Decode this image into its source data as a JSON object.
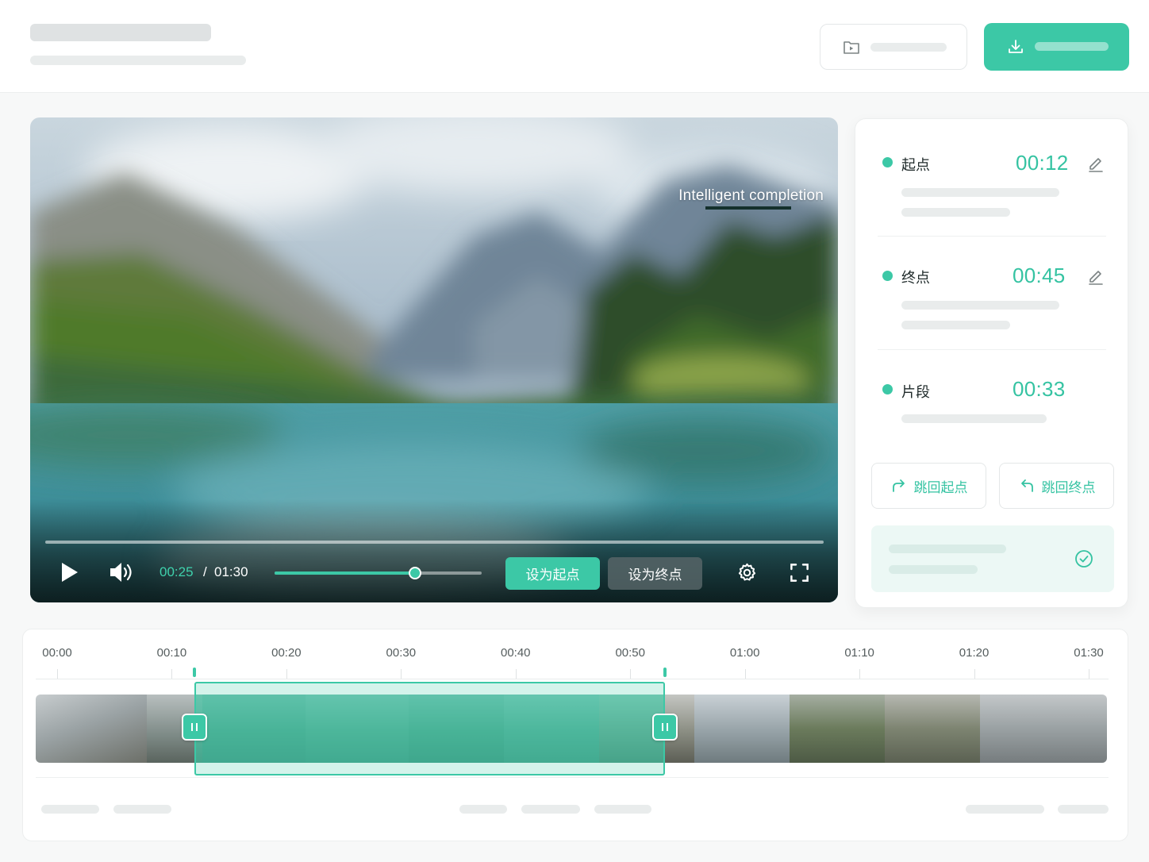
{
  "header": {
    "title_placeholder": "",
    "subtitle_placeholder": "",
    "open_button_icon": "video-file-icon",
    "export_button_icon": "download-icon"
  },
  "video": {
    "overlay_text": "Intelligent completion",
    "current_time": "00:25",
    "separator": "/",
    "total_time": "01:30",
    "progress_fraction": 0.0,
    "volume_fraction": 0.68,
    "set_start_label": "设为起点",
    "set_end_label": "设为终点",
    "icons": [
      "play-icon",
      "volume-icon",
      "settings-icon",
      "fullscreen-icon"
    ]
  },
  "panel": {
    "rows": [
      {
        "label": "起点",
        "time": "00:12",
        "editable": true
      },
      {
        "label": "终点",
        "time": "00:45",
        "editable": true
      },
      {
        "label": "片段",
        "time": "00:33",
        "editable": false
      }
    ],
    "jump_start_label": "跳回起点",
    "jump_end_label": "跳回终点",
    "notice_icon": "check-circle-icon"
  },
  "timeline": {
    "ticks": [
      "00:00",
      "00:10",
      "00:20",
      "00:30",
      "00:40",
      "00:50",
      "01:00",
      "01:10",
      "01:20",
      "01:30"
    ],
    "selection_start_seconds": 12,
    "selection_end_seconds": 53,
    "duration_seconds": 90
  },
  "colors": {
    "accent": "#3cc8a6",
    "accent_text": "#35c3a2",
    "notice_bg": "#ecf8f5"
  }
}
